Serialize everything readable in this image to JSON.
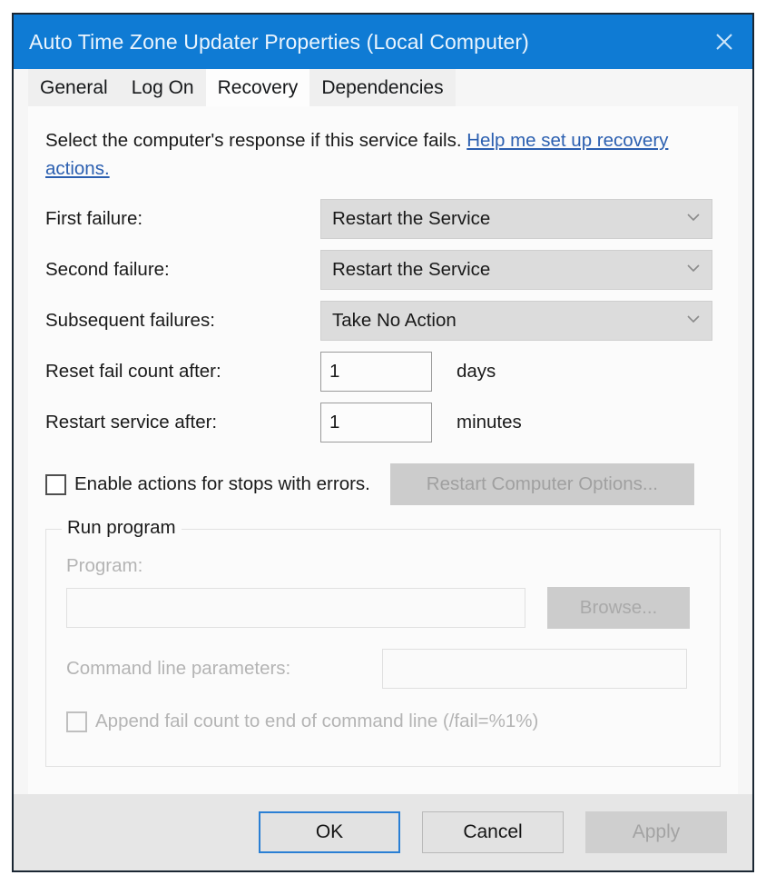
{
  "window": {
    "title": "Auto Time Zone Updater Properties (Local Computer)",
    "close_icon": "close-icon",
    "titlebar_color": "#0f7bd4"
  },
  "tabs": [
    {
      "label": "General",
      "active": false
    },
    {
      "label": "Log On",
      "active": false
    },
    {
      "label": "Recovery",
      "active": true
    },
    {
      "label": "Dependencies",
      "active": false
    }
  ],
  "intro": {
    "text": "Select the computer's response if this service fails.",
    "link_text": "Help me set up recovery actions.",
    "link_color": "#2b5fb0"
  },
  "failure_rows": [
    {
      "label": "First failure:",
      "value": "Restart the Service"
    },
    {
      "label": "Second failure:",
      "value": "Restart the Service"
    },
    {
      "label": "Subsequent failures:",
      "value": "Take No Action"
    }
  ],
  "counters": [
    {
      "label": "Reset fail count after:",
      "value": "1",
      "unit": "days"
    },
    {
      "label": "Restart service after:",
      "value": "1",
      "unit": "minutes"
    }
  ],
  "enable_actions": {
    "label": "Enable actions for stops with errors.",
    "checked": false
  },
  "restart_computer_options": {
    "label": "Restart Computer Options...",
    "enabled": false
  },
  "run_program": {
    "title": "Run program",
    "program_label": "Program:",
    "program_value": "",
    "program_placeholder": "",
    "browse_label": "Browse...",
    "command_label": "Command line parameters:",
    "command_value": "",
    "command_placeholder": "",
    "append_label": "Append fail count to end of command line (/fail=%1%)",
    "append_checked": false,
    "enabled": false
  },
  "footer": {
    "ok_label": "OK",
    "cancel_label": "Cancel",
    "apply_label": "Apply",
    "apply_enabled": false
  }
}
